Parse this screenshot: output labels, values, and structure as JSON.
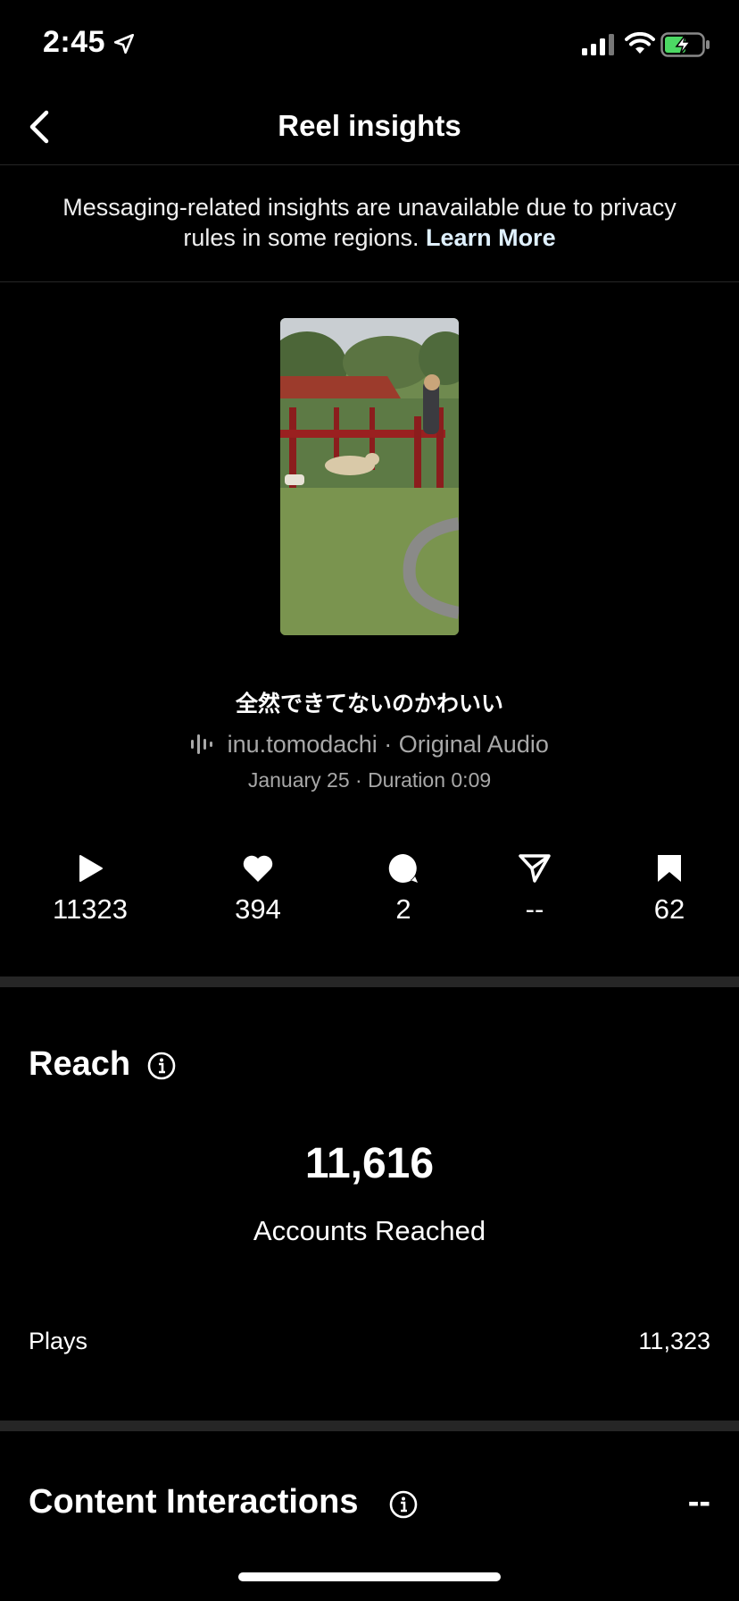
{
  "status_bar": {
    "time": "2:45"
  },
  "nav": {
    "title": "Reel insights"
  },
  "notice": {
    "text": "Messaging-related insights are unavailable due to privacy rules in some regions.",
    "link": "Learn More"
  },
  "reel": {
    "caption": "全然できてないのかわいい",
    "audio": "inu.tomodachi · Original Audio",
    "date_duration": "January 25 · Duration 0:09"
  },
  "metrics": [
    {
      "icon": "play-icon",
      "value": "11323"
    },
    {
      "icon": "heart-icon",
      "value": "394"
    },
    {
      "icon": "comment-icon",
      "value": "2"
    },
    {
      "icon": "share-icon",
      "value": "--"
    },
    {
      "icon": "bookmark-icon",
      "value": "62"
    }
  ],
  "reach": {
    "heading": "Reach",
    "accounts_reached_value": "11,616",
    "accounts_reached_label": "Accounts Reached",
    "plays_label": "Plays",
    "plays_value": "11,323"
  },
  "content_interactions": {
    "heading": "Content Interactions",
    "value": "--"
  },
  "colors": {
    "background": "#000000",
    "secondary_text": "#a8a8a8",
    "divider": "#262626",
    "battery_charging": "#4cd964"
  }
}
